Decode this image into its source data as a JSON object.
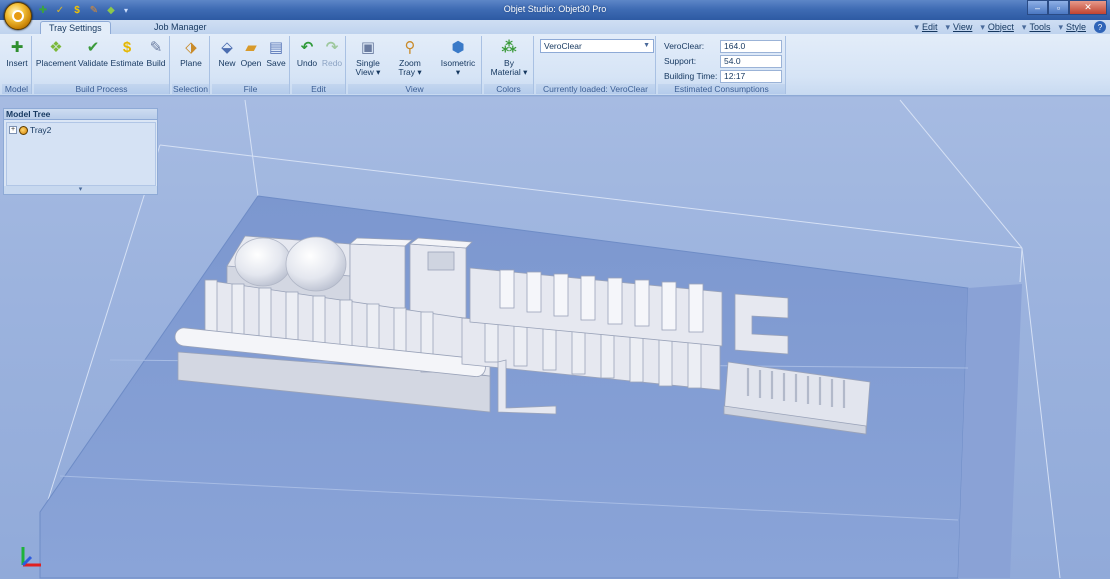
{
  "window": {
    "title": "Objet Studio: Objet30 Pro"
  },
  "quick_access": {
    "icons": [
      "build-process-icon",
      "validate-icon",
      "estimate-icon",
      "build-icon",
      "placement-icon"
    ],
    "dropdown": "▾"
  },
  "window_controls": {
    "minimize": "–",
    "restore": "▫",
    "close": "✕"
  },
  "tabs": [
    {
      "label": "Tray Settings",
      "active": true
    },
    {
      "label": "Job Manager",
      "active": false
    }
  ],
  "right_menu": [
    "Edit",
    "View",
    "Object",
    "Tools",
    "Style"
  ],
  "help": "?",
  "ribbon": {
    "groups": [
      {
        "label": "Model",
        "buttons": [
          {
            "label": "Insert",
            "icon": "insert-icon"
          }
        ]
      },
      {
        "label": "Build Process",
        "buttons": [
          {
            "label": "Placement",
            "icon": "placement-icon"
          },
          {
            "label": "Validate",
            "icon": "validate-icon"
          },
          {
            "label": "Estimate",
            "icon": "estimate-icon"
          },
          {
            "label": "Build",
            "icon": "build-icon"
          }
        ]
      },
      {
        "label": "Selection",
        "buttons": [
          {
            "label": "Plane",
            "icon": "plane-icon"
          }
        ]
      },
      {
        "label": "File",
        "buttons": [
          {
            "label": "New",
            "icon": "new-icon"
          },
          {
            "label": "Open",
            "icon": "open-icon"
          },
          {
            "label": "Save",
            "icon": "save-icon"
          }
        ]
      },
      {
        "label": "Edit",
        "buttons": [
          {
            "label": "Undo",
            "icon": "undo-icon"
          },
          {
            "label": "Redo",
            "icon": "redo-icon",
            "disabled": true
          }
        ]
      },
      {
        "label": "View",
        "buttons": [
          {
            "label": "Single",
            "label2": "View ▾",
            "icon": "single-view-icon"
          },
          {
            "label": "Zoom",
            "label2": "Tray ▾",
            "icon": "zoom-icon"
          },
          {
            "label": "Isometric",
            "label2": "▾",
            "icon": "isometric-icon"
          }
        ]
      },
      {
        "label": "Colors",
        "buttons": [
          {
            "label": "By",
            "label2": "Material ▾",
            "icon": "by-material-icon"
          }
        ]
      },
      {
        "label": "Currently loaded: VeroClear",
        "select_value": "VeroClear"
      },
      {
        "label": "Estimated Consumptions"
      }
    ],
    "consumptions": [
      {
        "label": "VeroClear:",
        "value": "164.0"
      },
      {
        "label": "Support:",
        "value": "54.0"
      },
      {
        "label": "Building Time:",
        "value": "12:17"
      }
    ]
  },
  "model_tree": {
    "title": "Model Tree",
    "items": [
      {
        "label": "Tray2",
        "expander": "+"
      }
    ],
    "footer": "▾"
  },
  "colors": {
    "tray": "#7f9ad1",
    "model": "#e6e8f0",
    "ribbon": "#dbe7f7",
    "titlebar": "#3f6cb4"
  }
}
